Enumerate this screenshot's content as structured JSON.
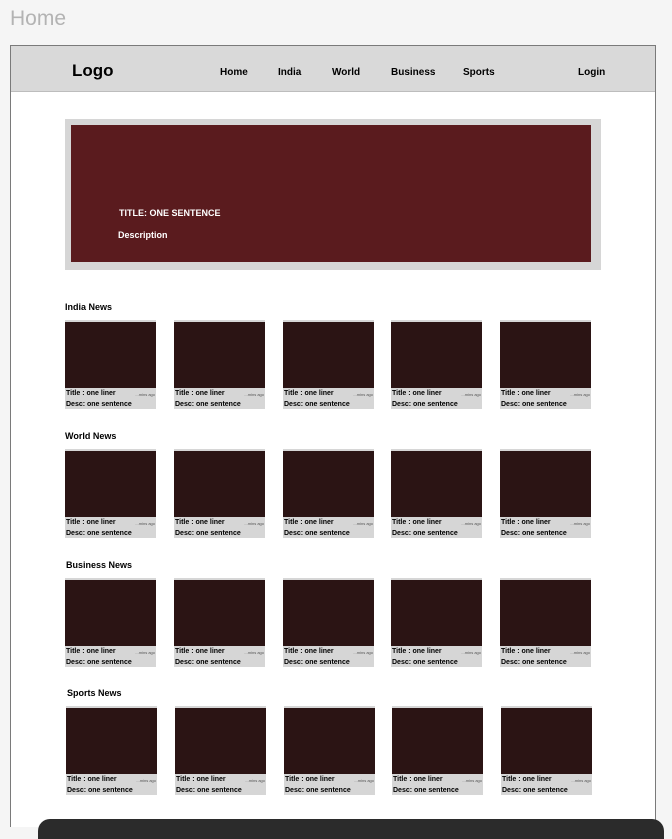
{
  "page_label": "Home",
  "nav": {
    "logo": "Logo",
    "links": [
      "Home",
      "India",
      "World",
      "Business",
      "Sports"
    ],
    "login": "Login"
  },
  "hero": {
    "title": "TITLE: ONE SENTENCE",
    "description": "Description"
  },
  "sections": [
    {
      "title": "India News",
      "cards": [
        {
          "title": "Title :  one liner",
          "time": "...mins ago",
          "desc": "Desc: one sentence"
        },
        {
          "title": "Title :  one liner",
          "time": "...mins ago",
          "desc": "Desc: one sentence"
        },
        {
          "title": "Title :  one liner",
          "time": "...mins ago",
          "desc": "Desc: one sentence"
        },
        {
          "title": "Title :  one liner",
          "time": "...mins ago",
          "desc": "Desc: one sentence"
        },
        {
          "title": "Title :  one liner",
          "time": "...mins ago",
          "desc": "Desc: one sentence"
        }
      ]
    },
    {
      "title": "World News",
      "cards": [
        {
          "title": "Title :  one liner",
          "time": "...mins ago",
          "desc": "Desc: one sentence"
        },
        {
          "title": "Title :  one liner",
          "time": "...mins ago",
          "desc": "Desc: one sentence"
        },
        {
          "title": "Title :  one liner",
          "time": "...mins ago",
          "desc": "Desc: one sentence"
        },
        {
          "title": "Title :  one liner",
          "time": "...mins ago",
          "desc": "Desc: one sentence"
        },
        {
          "title": "Title :  one liner",
          "time": "...mins ago",
          "desc": "Desc: one sentence"
        }
      ]
    },
    {
      "title": "Business News",
      "cards": [
        {
          "title": "Title :  one liner",
          "time": "...mins ago",
          "desc": "Desc: one sentence"
        },
        {
          "title": "Title :  one liner",
          "time": "...mins ago",
          "desc": "Desc: one sentence"
        },
        {
          "title": "Title :  one liner",
          "time": "...mins ago",
          "desc": "Desc: one sentence"
        },
        {
          "title": "Title :  one liner",
          "time": "...mins ago",
          "desc": "Desc: one sentence"
        },
        {
          "title": "Title :  one liner",
          "time": "...mins ago",
          "desc": "Desc: one sentence"
        }
      ]
    },
    {
      "title": "Sports News",
      "cards": [
        {
          "title": "Title :  one liner",
          "time": "...mins ago",
          "desc": "Desc: one sentence"
        },
        {
          "title": "Title :  one liner",
          "time": "...mins ago",
          "desc": "Desc: one sentence"
        },
        {
          "title": "Title :  one liner",
          "time": "...mins ago",
          "desc": "Desc: one sentence"
        },
        {
          "title": "Title :  one liner",
          "time": "...mins ago",
          "desc": "Desc: one sentence"
        },
        {
          "title": "Title :  one liner",
          "time": "...mins ago",
          "desc": "Desc: one sentence"
        }
      ]
    }
  ]
}
